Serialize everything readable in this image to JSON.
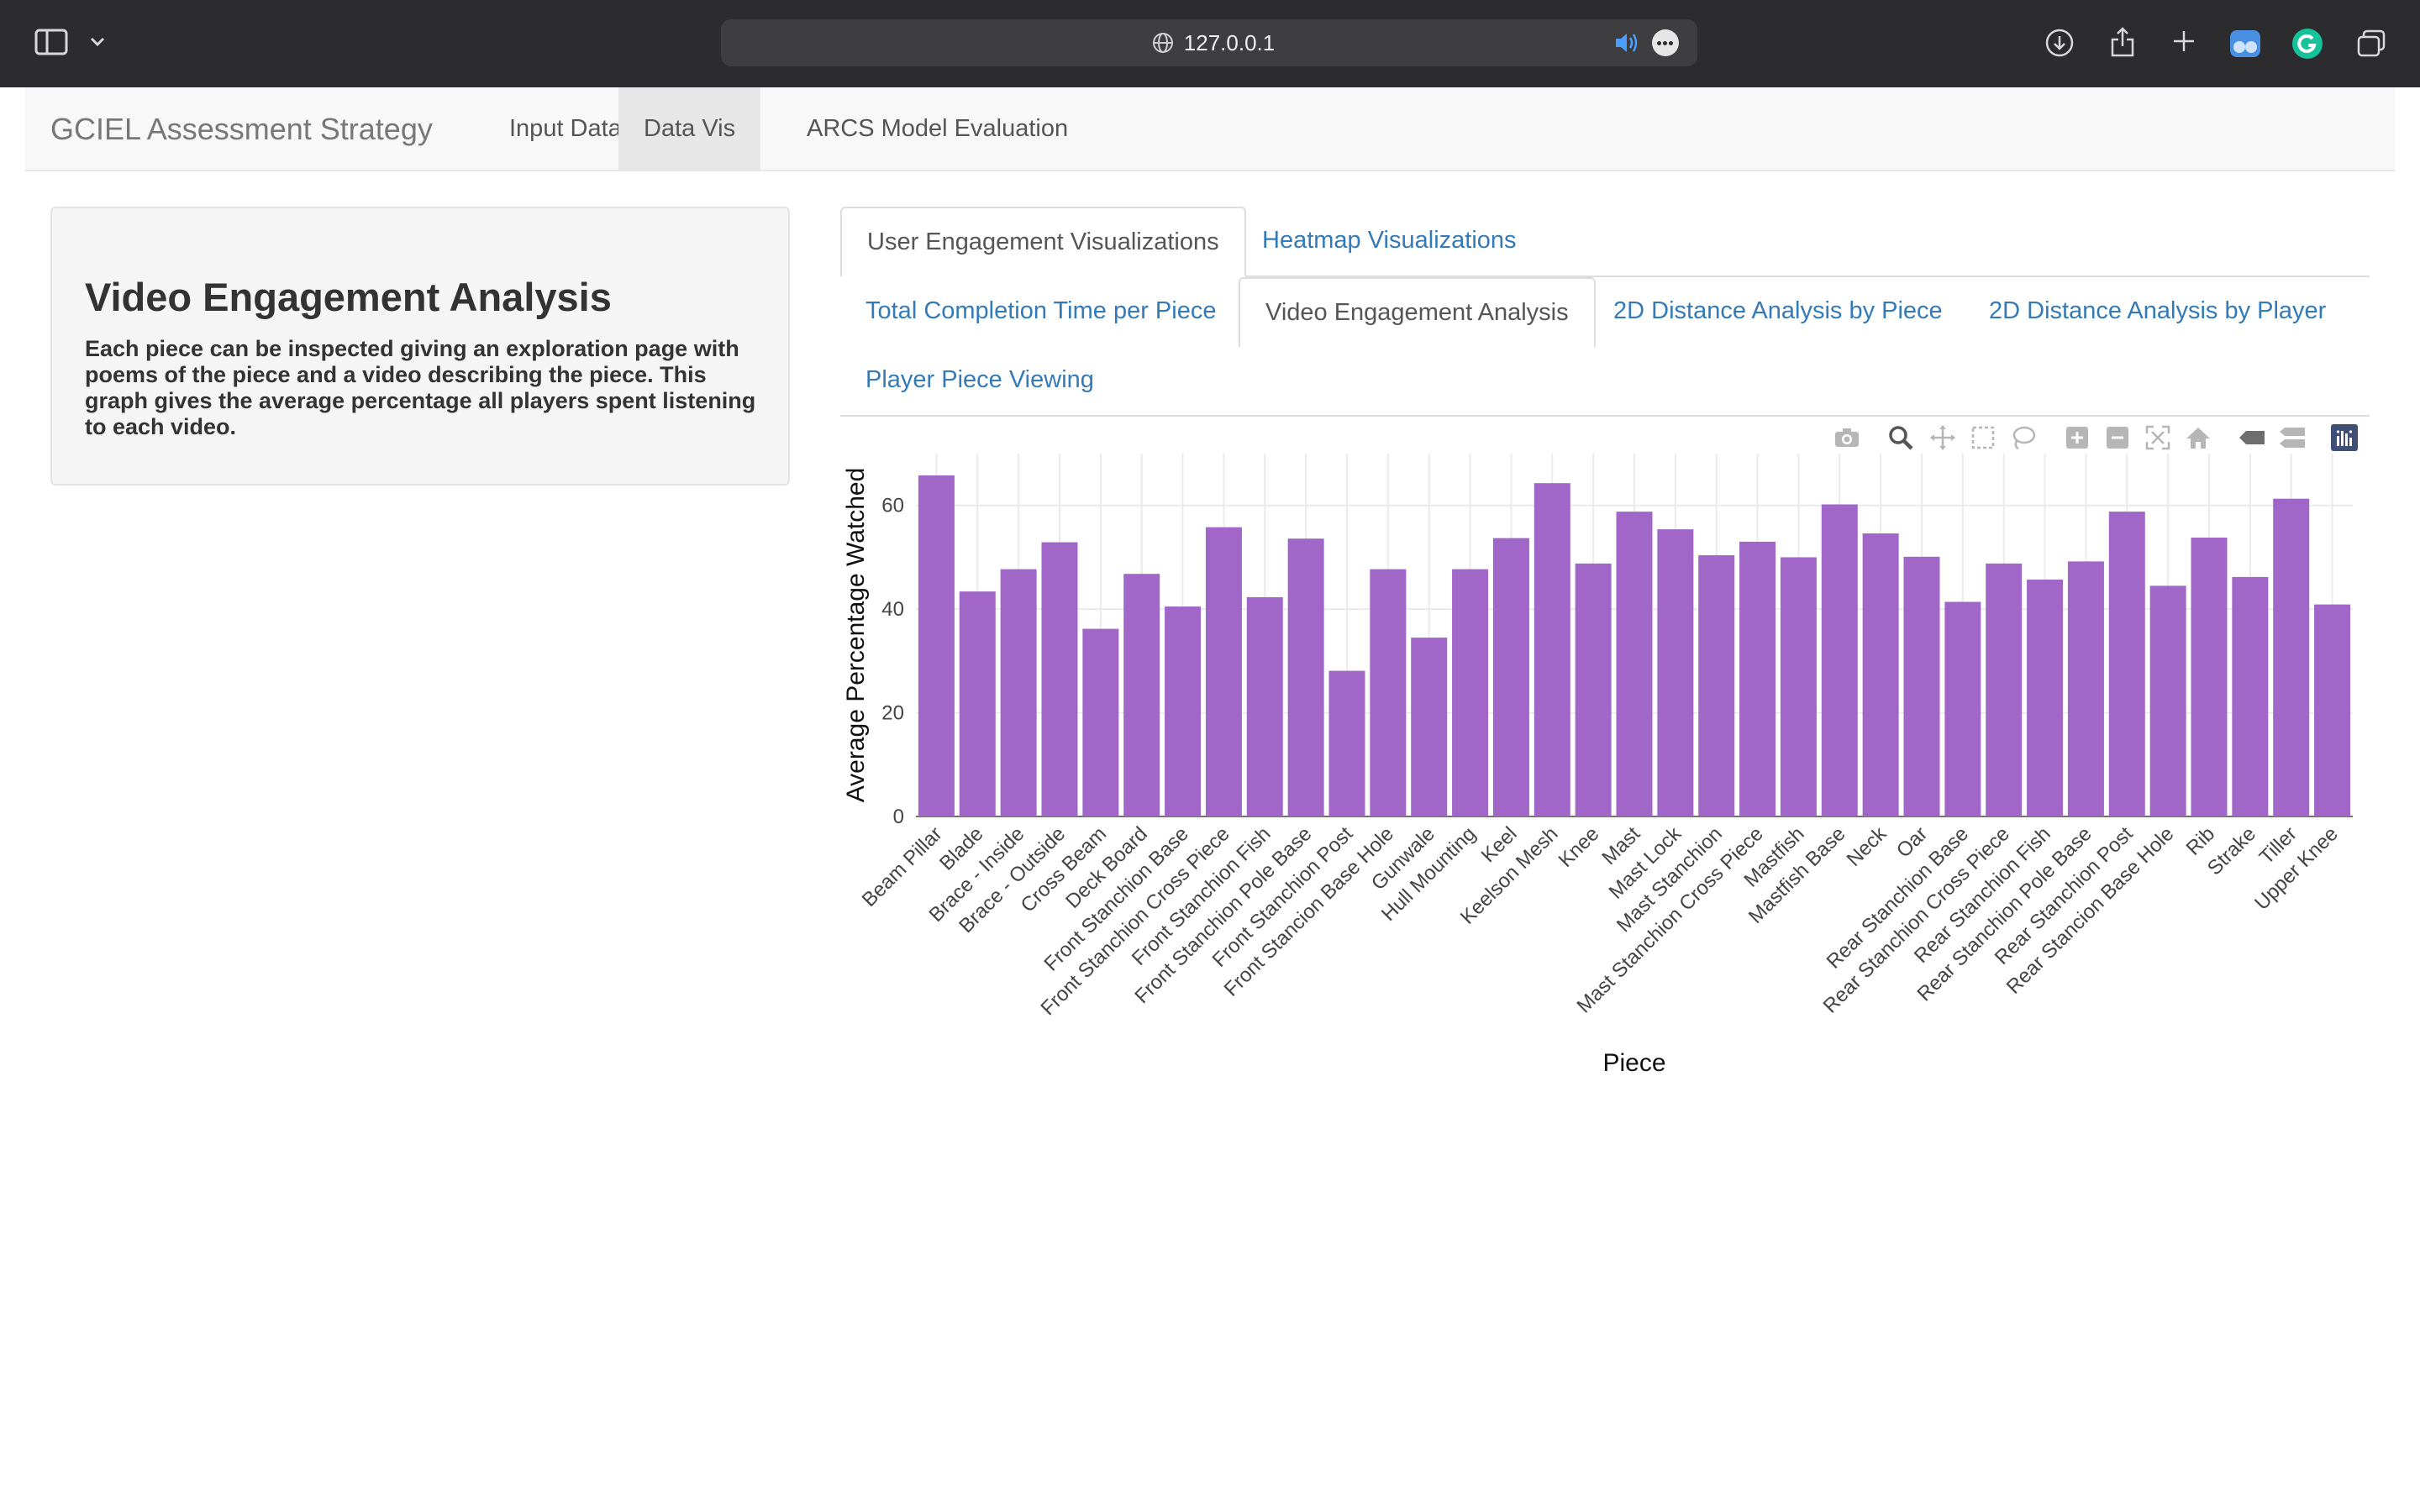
{
  "browser": {
    "url": "127.0.0.1",
    "icons": [
      "sidebar-icon",
      "chevron-down-icon",
      "globe-icon",
      "speaker-icon",
      "more-icon",
      "download-icon",
      "share-icon",
      "plus-icon",
      "extension-icon",
      "grammarly-icon",
      "tabs-overview-icon"
    ]
  },
  "navbar": {
    "brand": "GCIEL Assessment Strategy",
    "items": [
      {
        "label": "Input Data"
      },
      {
        "label": "Data Vis"
      },
      {
        "label": "ARCS Model Evaluation"
      }
    ]
  },
  "sidebar": {
    "title": "Video Engagement Analysis",
    "description": "Each piece can be inspected giving an exploration page with poems of the piece and a video describing the piece. This graph gives the average percentage all players spent listening to each video."
  },
  "tabs_primary": [
    {
      "label": "User Engagement Visualizations"
    },
    {
      "label": "Heatmap Visualizations"
    }
  ],
  "tabs_secondary": [
    {
      "label": "Total Completion Time per Piece"
    },
    {
      "label": "Video Engagement Analysis"
    },
    {
      "label": "2D Distance Analysis by Piece"
    },
    {
      "label": "2D Distance Analysis by Player"
    },
    {
      "label": "Player Piece Viewing"
    }
  ],
  "modebar": [
    "camera-icon",
    "zoom-icon",
    "pan-icon",
    "box-select-icon",
    "lasso-select-icon",
    "zoom-in-icon",
    "zoom-out-icon",
    "autoscale-icon",
    "home-icon",
    "hover-closest-icon",
    "hover-compare-icon",
    "plotly-logo-icon"
  ],
  "chart_data": {
    "type": "bar",
    "xlabel": "Piece",
    "ylabel": "Average Percentage Watched",
    "ylim": [
      0,
      70
    ],
    "yticks": [
      0,
      20,
      40,
      60
    ],
    "bar_color": "#a066c8",
    "grid": true,
    "categories": [
      "Beam Pillar",
      "Blade",
      "Brace - Inside",
      "Brace - Outside",
      "Cross Beam",
      "Deck Board",
      "Front Stanchion Base",
      "Front Stanchion Cross Piece",
      "Front Stanchion Fish",
      "Front Stanchion Pole Base",
      "Front Stanchion Post",
      "Front Stancion Base Hole",
      "Gunwale",
      "Hull Mounting",
      "Keel",
      "Keelson Mesh",
      "Knee",
      "Mast",
      "Mast Lock",
      "Mast Stanchion",
      "Mast Stanchion Cross Piece",
      "Mastfish",
      "Mastfish Base",
      "Neck",
      "Oar",
      "Rear Stanchion Base",
      "Rear Stanchion Cross Piece",
      "Rear Stanchion Fish",
      "Rear Stanchion Pole Base",
      "Rear Stanchion Post",
      "Rear Stancion Base Hole",
      "Rib",
      "Strake",
      "Tiller",
      "Upper Knee"
    ],
    "values": [
      65.8,
      43.4,
      47.7,
      52.9,
      36.2,
      46.8,
      40.5,
      55.8,
      42.3,
      53.6,
      28.1,
      47.7,
      34.5,
      47.7,
      53.7,
      64.3,
      48.8,
      58.8,
      55.4,
      50.4,
      53.0,
      50.0,
      60.2,
      54.6,
      50.1,
      41.4,
      48.8,
      45.7,
      49.2,
      58.8,
      44.5,
      53.8,
      46.2,
      61.3,
      40.9
    ]
  }
}
